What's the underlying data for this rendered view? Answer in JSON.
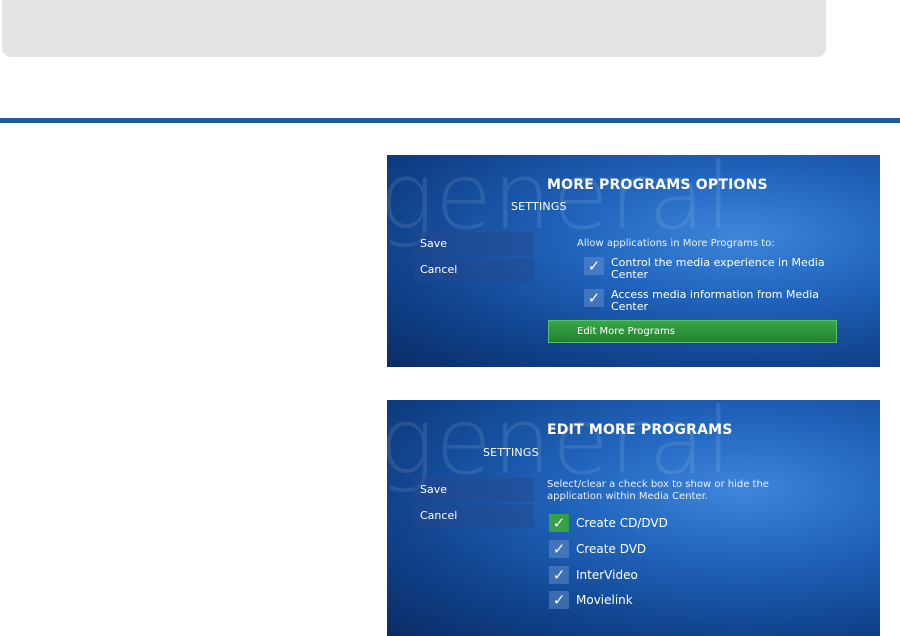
{
  "panel1": {
    "watermark": "general",
    "settings_label": "SETTINGS",
    "save_label": "Save",
    "cancel_label": "Cancel",
    "title": "MORE PROGRAMS OPTIONS",
    "instruction": "Allow applications in More Programs to:",
    "options": [
      {
        "label": "Control the media experience in Media Center",
        "checked": true
      },
      {
        "label": "Access media information from Media Center",
        "checked": true
      }
    ],
    "edit_button_label": "Edit More Programs"
  },
  "panel2": {
    "watermark": "general",
    "settings_label": "SETTINGS",
    "save_label": "Save",
    "cancel_label": "Cancel",
    "title": "EDIT MORE PROGRAMS",
    "instruction": "Select/clear a check box to show or hide the application within Media Center.",
    "programs": [
      {
        "label": "Create CD/DVD",
        "checked": true,
        "focused": true
      },
      {
        "label": "Create DVD",
        "checked": true
      },
      {
        "label": "InterVideo",
        "checked": true
      },
      {
        "label": "Movielink",
        "checked": true
      }
    ]
  },
  "check_glyph": "✓",
  "colors": {
    "rule": "#1d5aa0",
    "focus_green": "#36a047",
    "panel_blue": "#2266bf"
  }
}
